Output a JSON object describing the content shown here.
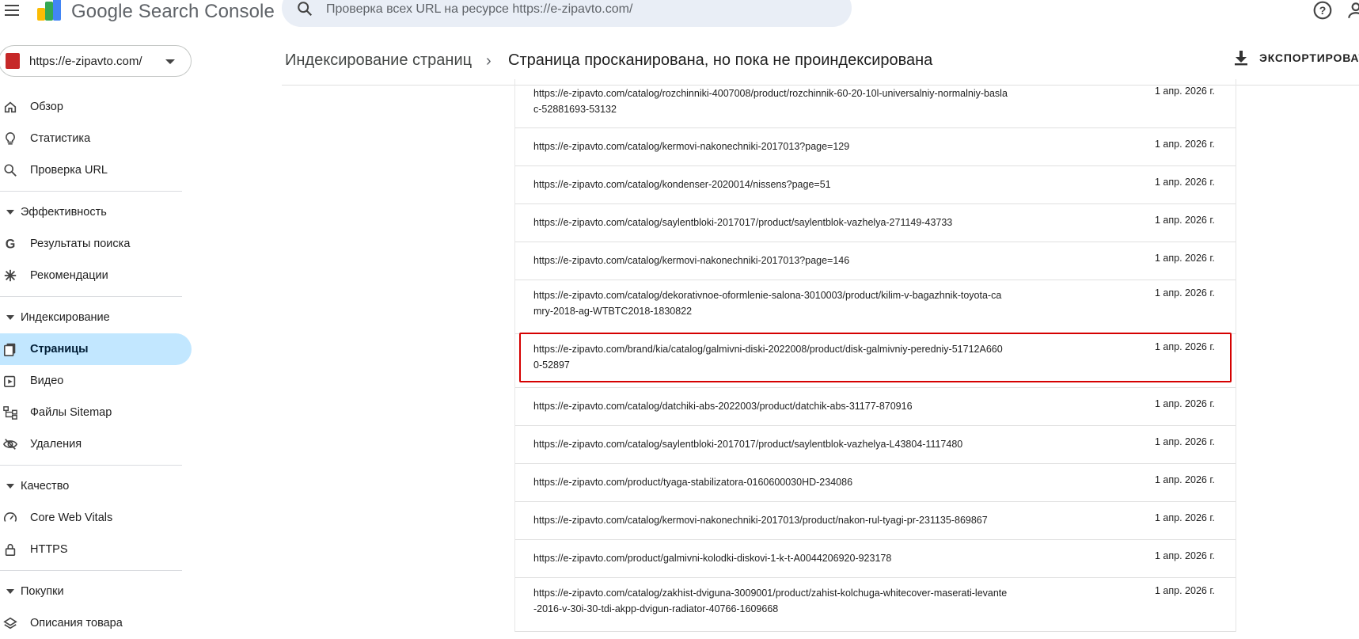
{
  "app": {
    "name": "Google Search Console"
  },
  "search": {
    "placeholder": "Проверка всех URL на ресурсе https://e-zipavto.com/"
  },
  "property": {
    "url": "https://e-zipavto.com/"
  },
  "sidebar": {
    "top_items": [
      {
        "label": "Обзор",
        "icon": "home-icon"
      },
      {
        "label": "Статистика",
        "icon": "lightbulb-icon"
      },
      {
        "label": "Проверка URL",
        "icon": "search-icon"
      }
    ],
    "sections": [
      {
        "title": "Эффективность",
        "items": [
          {
            "label": "Результаты поиска",
            "icon": "google-g-icon"
          },
          {
            "label": "Рекомендации",
            "icon": "asterisk-icon"
          }
        ]
      },
      {
        "title": "Индексирование",
        "items": [
          {
            "label": "Страницы",
            "icon": "pages-icon",
            "active": true
          },
          {
            "label": "Видео",
            "icon": "video-icon"
          },
          {
            "label": "Файлы Sitemap",
            "icon": "sitemap-icon"
          },
          {
            "label": "Удаления",
            "icon": "eye-off-icon"
          }
        ]
      },
      {
        "title": "Качество",
        "items": [
          {
            "label": "Core Web Vitals",
            "icon": "gauge-icon"
          },
          {
            "label": "HTTPS",
            "icon": "lock-icon"
          }
        ]
      },
      {
        "title": "Покупки",
        "items": [
          {
            "label": "Описания товара",
            "icon": "layers-icon"
          }
        ]
      }
    ]
  },
  "breadcrumb": {
    "parent": "Индексирование страниц",
    "separator": "›",
    "current": "Страница просканирована, но пока не проиндексирована"
  },
  "toolbar": {
    "export_label": "ЭКСПОРТИРОВАТЬ"
  },
  "table": {
    "rows": [
      {
        "url": "https://e-zipavto.com/catalog/rozchinniki-4007008/product/rozchinnik-60-20-10l-universalniy-normalniy-basla\nc-52881693-53132",
        "date": "1 апр. 2026 г."
      },
      {
        "url": "https://e-zipavto.com/catalog/kermovi-nakonechniki-2017013?page=129",
        "date": "1 апр. 2026 г."
      },
      {
        "url": "https://e-zipavto.com/catalog/kondenser-2020014/nissens?page=51",
        "date": "1 апр. 2026 г."
      },
      {
        "url": "https://e-zipavto.com/catalog/saylentbloki-2017017/product/saylentblok-vazhelya-271149-43733",
        "date": "1 апр. 2026 г."
      },
      {
        "url": "https://e-zipavto.com/catalog/kermovi-nakonechniki-2017013?page=146",
        "date": "1 апр. 2026 г."
      },
      {
        "url": "https://e-zipavto.com/catalog/dekorativnoe-oformlenie-salona-3010003/product/kilim-v-bagazhnik-toyota-ca\nmry-2018-ag-WTBTC2018-1830822",
        "date": "1 апр. 2026 г."
      },
      {
        "url": "https://e-zipavto.com/brand/kia/catalog/galmivni-diski-2022008/product/disk-galmivniy-peredniy-51712A660\n0-52897",
        "date": "1 апр. 2026 г.",
        "highlighted": true
      },
      {
        "url": "https://e-zipavto.com/catalog/datchiki-abs-2022003/product/datchik-abs-31177-870916",
        "date": "1 апр. 2026 г."
      },
      {
        "url": "https://e-zipavto.com/catalog/saylentbloki-2017017/product/saylentblok-vazhelya-L43804-1117480",
        "date": "1 апр. 2026 г."
      },
      {
        "url": "https://e-zipavto.com/product/tyaga-stabilizatora-0160600030HD-234086",
        "date": "1 апр. 2026 г."
      },
      {
        "url": "https://e-zipavto.com/catalog/kermovi-nakonechniki-2017013/product/nakon-rul-tyagi-pr-231135-869867",
        "date": "1 апр. 2026 г."
      },
      {
        "url": "https://e-zipavto.com/product/galmivni-kolodki-diskovi-1-k-t-A0044206920-923178",
        "date": "1 апр. 2026 г."
      },
      {
        "url": "https://e-zipavto.com/catalog/zakhist-dviguna-3009001/product/zahist-kolchuga-whitecover-maserati-levante\n-2016-v-30i-30-tdi-akpp-dvigun-radiator-40766-1609668",
        "date": "1 апр. 2026 г."
      }
    ]
  },
  "colors": {
    "active_nav": "#c2e7ff",
    "highlight_border": "#d50000",
    "search_bg": "#e9eef6"
  }
}
